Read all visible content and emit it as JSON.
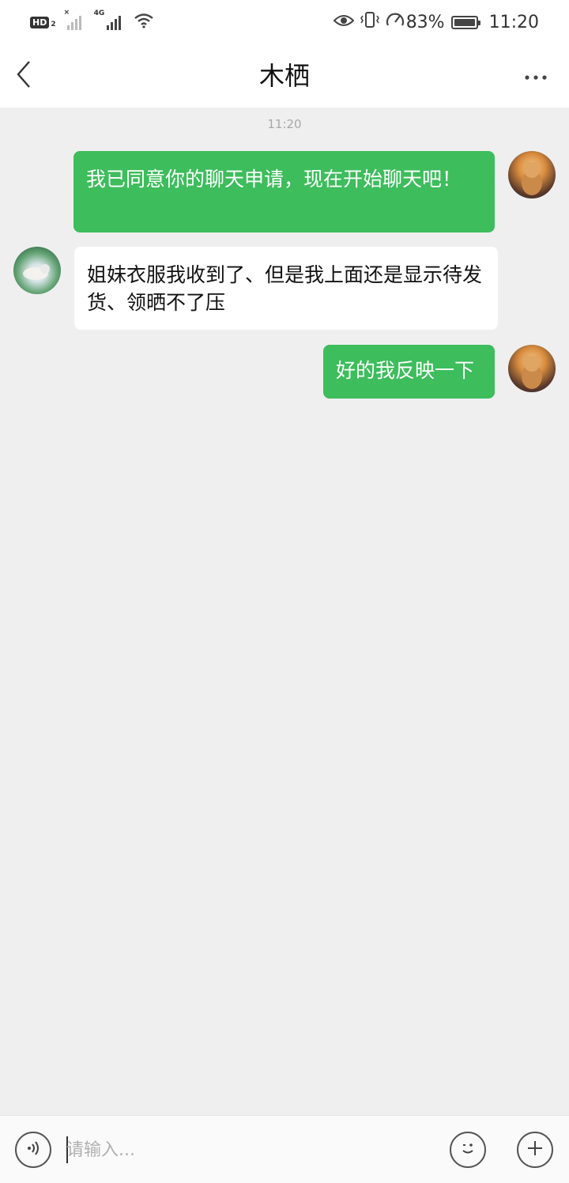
{
  "status_bar": {
    "network_badge": "HD",
    "network_sub": "2",
    "signal_tag": "4G",
    "battery_percent": "83%",
    "time": "11:20"
  },
  "header": {
    "title": "木栖"
  },
  "chat": {
    "timestamp": "11:20",
    "messages": [
      {
        "direction": "out",
        "text": "我已同意你的聊天申请，现在开始聊天吧！"
      },
      {
        "direction": "in",
        "text": "姐妹衣服我收到了、但是我上面还是显示待发货、领晒不了压"
      },
      {
        "direction": "out",
        "text": "好的我反映一下"
      }
    ]
  },
  "input_bar": {
    "placeholder": "请输入...",
    "value": ""
  },
  "colors": {
    "outgoing_bubble": "#3dbd5c",
    "incoming_bubble": "#ffffff",
    "background": "#efefef"
  }
}
